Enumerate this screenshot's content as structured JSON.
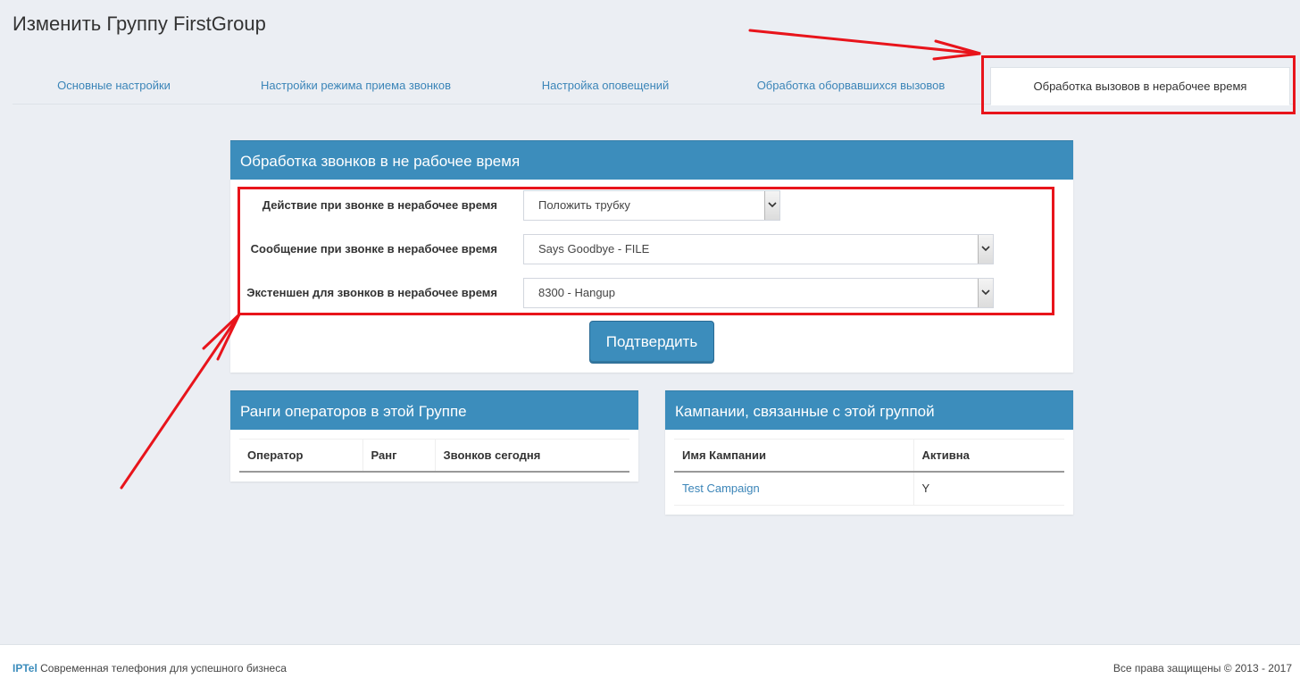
{
  "page_title": "Изменить Группу FirstGroup",
  "tabs": [
    {
      "label": "Основные настройки"
    },
    {
      "label": "Настройки режима приема звонков"
    },
    {
      "label": "Настройка оповещений"
    },
    {
      "label": "Обработка оборвавшихся вызовов"
    },
    {
      "label": "Обработка вызовов в нерабочее время"
    }
  ],
  "after_hours_panel": {
    "title": "Обработка звонков в не рабочее время",
    "fields": [
      {
        "label": "Действие при звонке в нерабочее время",
        "value": "Положить трубку"
      },
      {
        "label": "Сообщение при звонке в нерабочее время",
        "value": "Says Goodbye - FILE"
      },
      {
        "label": "Экстеншен для звонков в нерабочее время",
        "value": "8300 - Hangup"
      }
    ],
    "submit_label": "Подтвердить"
  },
  "ranks_panel": {
    "title": "Ранги операторов в этой Группе",
    "columns": [
      "Оператор",
      "Ранг",
      "Звонков сегодня"
    ],
    "rows": []
  },
  "campaigns_panel": {
    "title": "Кампании, связанные с этой группой",
    "columns": [
      "Имя Кампании",
      "Активна"
    ],
    "rows": [
      {
        "name": "Test Campaign",
        "active": "Y"
      }
    ]
  },
  "footer": {
    "brand": "IPTel",
    "tagline": "Современная телефония для успешного бизнеса",
    "copyright": "Все права защищены © 2013 - 2017"
  },
  "colors": {
    "accent": "#3c8dbc",
    "link": "#3b85b8",
    "annotation": "#e8141b",
    "background": "#ebeef3"
  },
  "icons": [
    "chevron-down-icon"
  ]
}
